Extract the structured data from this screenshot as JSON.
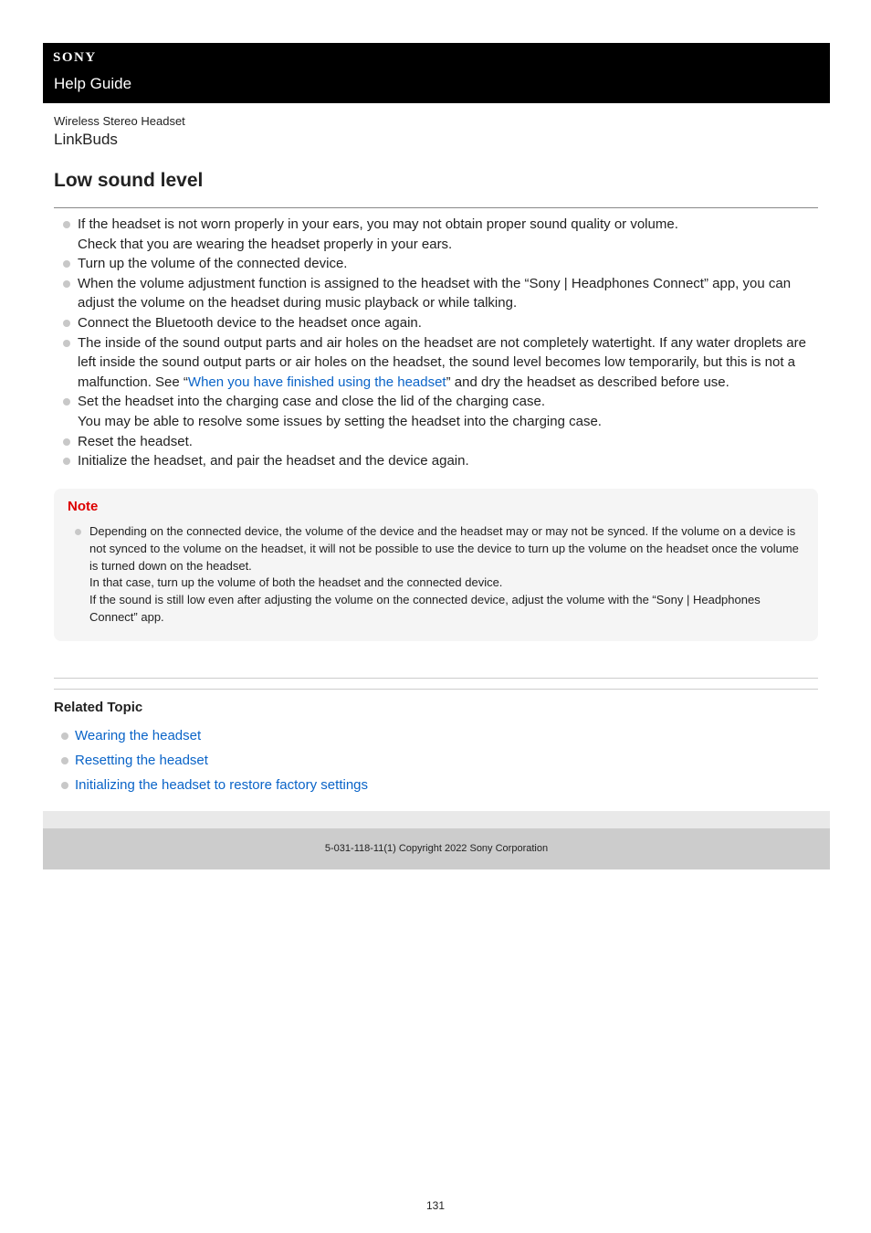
{
  "header": {
    "brand": "SONY",
    "guide": "Help Guide"
  },
  "product": {
    "type": "Wireless Stereo Headset",
    "name": "LinkBuds"
  },
  "page_title": "Low sound level",
  "items": [
    {
      "lines": [
        "If the headset is not worn properly in your ears, you may not obtain proper sound quality or volume.",
        "Check that you are wearing the headset properly in your ears."
      ]
    },
    {
      "lines": [
        "Turn up the volume of the connected device."
      ]
    },
    {
      "lines": [
        "When the volume adjustment function is assigned to the headset with the “Sony | Headphones Connect” app, you can adjust the volume on the headset during music playback or while talking."
      ]
    },
    {
      "lines": [
        "Connect the Bluetooth device to the headset once again."
      ]
    },
    {
      "before": "The inside of the sound output parts and air holes on the headset are not completely watertight. If any water droplets are left inside the sound output parts or air holes on the headset, the sound level becomes low temporarily, but this is not a malfunction. See “",
      "link": "When you have finished using the headset",
      "after": "” and dry the headset as described before use."
    },
    {
      "lines": [
        "Set the headset into the charging case and close the lid of the charging case.",
        "You may be able to resolve some issues by setting the headset into the charging case."
      ]
    },
    {
      "lines": [
        "Reset the headset."
      ]
    },
    {
      "lines": [
        "Initialize the headset, and pair the headset and the device again."
      ]
    }
  ],
  "note": {
    "title": "Note",
    "lines": [
      "Depending on the connected device, the volume of the device and the headset may or may not be synced. If the volume on a device is not synced to the volume on the headset, it will not be possible to use the device to turn up the volume on the headset once the volume is turned down on the headset.",
      "In that case, turn up the volume of both the headset and the connected device.",
      "If the sound is still low even after adjusting the volume on the connected device, adjust the volume with the “Sony | Headphones Connect” app."
    ]
  },
  "related": {
    "title": "Related Topic",
    "links": [
      "Wearing the headset",
      "Resetting the headset",
      "Initializing the headset to restore factory settings"
    ]
  },
  "footer": {
    "copyright": "5-031-118-11(1) Copyright 2022 Sony Corporation"
  },
  "page_number": "131"
}
